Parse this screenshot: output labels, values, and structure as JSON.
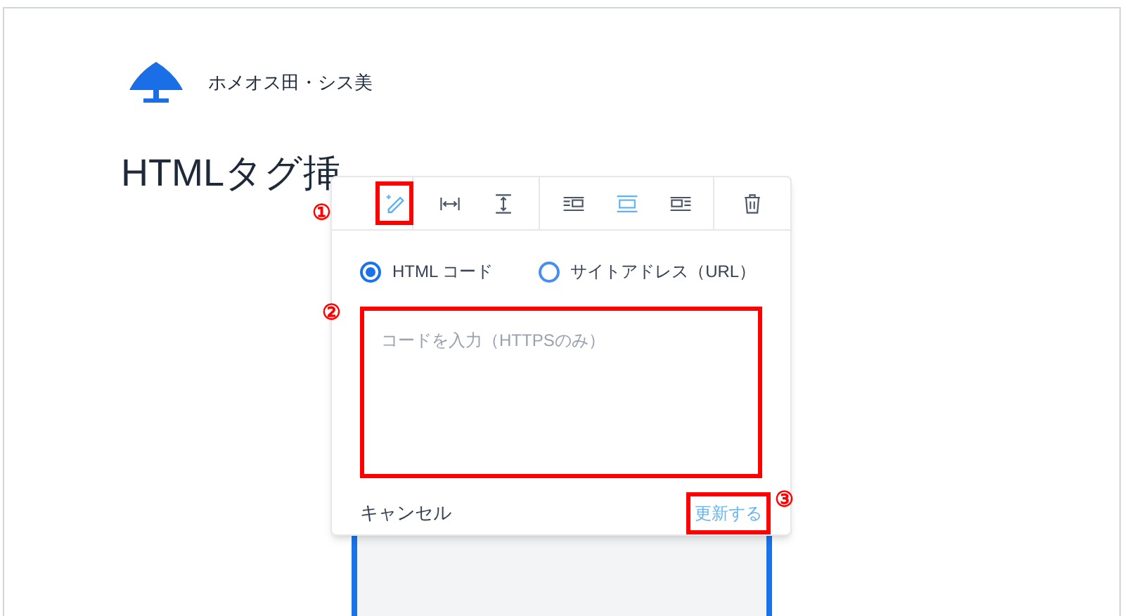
{
  "site": {
    "name": "ホメオス田・シス美"
  },
  "heading": "HTMLタグ挿",
  "popup": {
    "toolbar": [
      {
        "kind": "edit",
        "selected": true
      },
      {
        "kind": "width",
        "selected": false
      },
      {
        "kind": "height",
        "selected": false
      },
      {
        "kind": "align-left",
        "selected": false
      },
      {
        "kind": "align-center",
        "selected": true
      },
      {
        "kind": "align-right",
        "selected": false
      },
      {
        "kind": "delete",
        "selected": false
      }
    ],
    "options": [
      {
        "label": "HTML コード",
        "selected": true
      },
      {
        "label": "サイトアドレス（URL）",
        "selected": false
      }
    ],
    "code_field": {
      "placeholder": "コードを入力（HTTPSのみ）"
    },
    "cancel": "キャンセル",
    "update": "更新する"
  },
  "annotations": [
    "①",
    "②",
    "③"
  ]
}
